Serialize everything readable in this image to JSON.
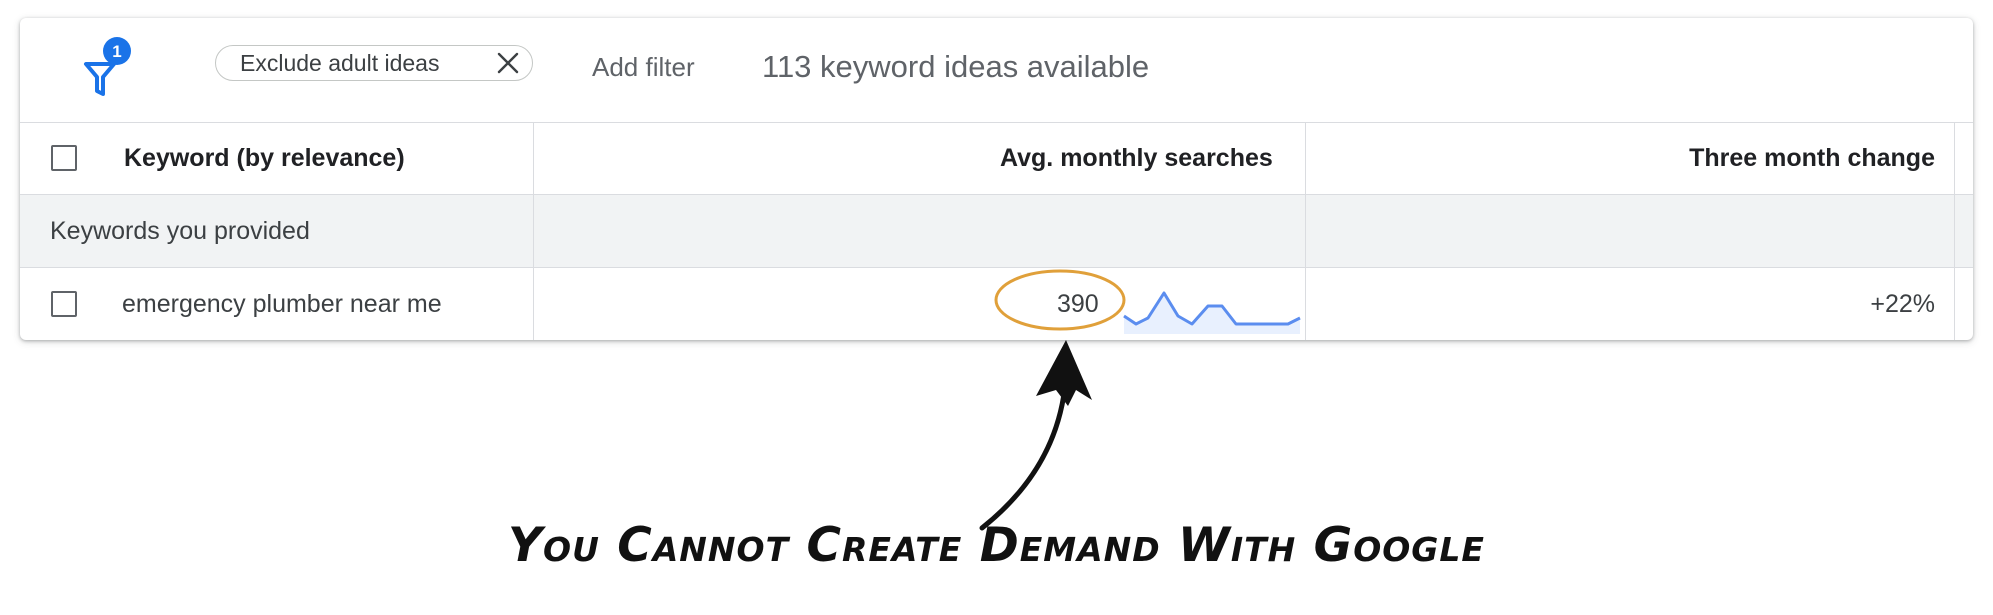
{
  "toolbar": {
    "filter_badge_count": "1",
    "chip_label": "Exclude adult ideas",
    "add_filter_label": "Add filter",
    "ideas_available": "113 keyword ideas available"
  },
  "table": {
    "columns": [
      "Keyword (by relevance)",
      "Avg. monthly searches",
      "Three month change"
    ],
    "group_label": "Keywords you provided",
    "rows": [
      {
        "keyword": "emergency plumber near me",
        "avg_monthly_searches": "390",
        "three_month_change": "+22%"
      }
    ]
  },
  "annotation": {
    "caption": "You Cannot Create Demand With Google",
    "highlight_color": "#e0a03a"
  },
  "colors": {
    "accent": "#1a73e8",
    "sparkline": "#5b8def"
  }
}
